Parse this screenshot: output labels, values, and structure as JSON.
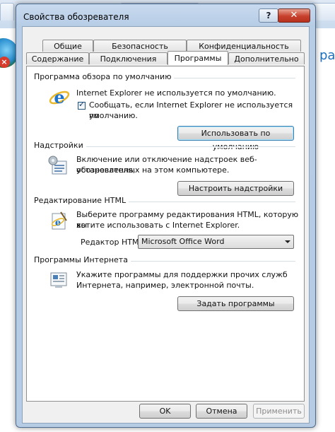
{
  "dialog": {
    "title": "Свойства обозревателя",
    "help_label": "?",
    "close_label": "✕"
  },
  "tabs": {
    "row_top": [
      "Общие",
      "Безопасность",
      "Конфиденциальность"
    ],
    "row_bottom": [
      "Содержание",
      "Подключения",
      "Программы",
      "Дополнительно"
    ],
    "active": "Программы"
  },
  "default_browser": {
    "title": "Программа обзора по умолчанию",
    "status": "Internet Explorer не используется по умолчанию.",
    "notify_line1": "Сообщать, если Internet Explorer не используется по",
    "notify_line2": "умолчанию.",
    "notify_checked": true,
    "button": "Использовать по умолчанию"
  },
  "addons": {
    "title": "Надстройки",
    "desc_line1": "Включение или отключение надстроек веб-обозревателя,",
    "desc_line2": "установленных на этом компьютере.",
    "button": "Настроить надстройки"
  },
  "html_editing": {
    "title": "Редактирование HTML",
    "desc_line1": "Выберите программу редактирования HTML, которую вы",
    "desc_line2": "хотите использовать с Internet Explorer.",
    "editor_label": "Редактор HTML:",
    "editor_value": "Microsoft Office Word"
  },
  "internet_programs": {
    "title": "Программы Интернета",
    "desc_line1": "Укажите программы для поддержки прочих служб",
    "desc_line2": "Интернета, например, электронной почты.",
    "button": "Задать программы"
  },
  "footer": {
    "ok": "OK",
    "cancel": "Отмена",
    "apply": "Применить"
  },
  "background": {
    "partial_text": "ранз"
  }
}
